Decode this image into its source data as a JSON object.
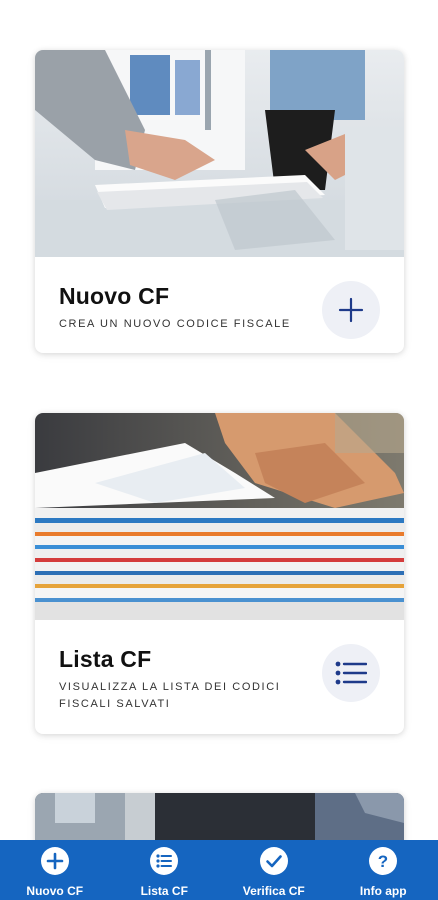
{
  "cards": [
    {
      "title": "Nuovo CF",
      "subtitle": "Crea un nuovo codice fiscale",
      "icon": "plus-icon"
    },
    {
      "title": "Lista CF",
      "subtitle": "Visualizza la lista dei codici fiscali salvati",
      "icon": "list-icon"
    },
    {
      "title": "",
      "subtitle": "",
      "icon": ""
    }
  ],
  "nav": [
    {
      "label": "Nuovo CF",
      "icon": "plus-circle-icon"
    },
    {
      "label": "Lista CF",
      "icon": "list-circle-icon"
    },
    {
      "label": "Verifica CF",
      "icon": "check-circle-icon"
    },
    {
      "label": "Info app",
      "icon": "question-circle-icon"
    }
  ],
  "colors": {
    "accent": "#1565c0",
    "button_bg": "#eef0f6",
    "icon": "#1e3a8a"
  }
}
